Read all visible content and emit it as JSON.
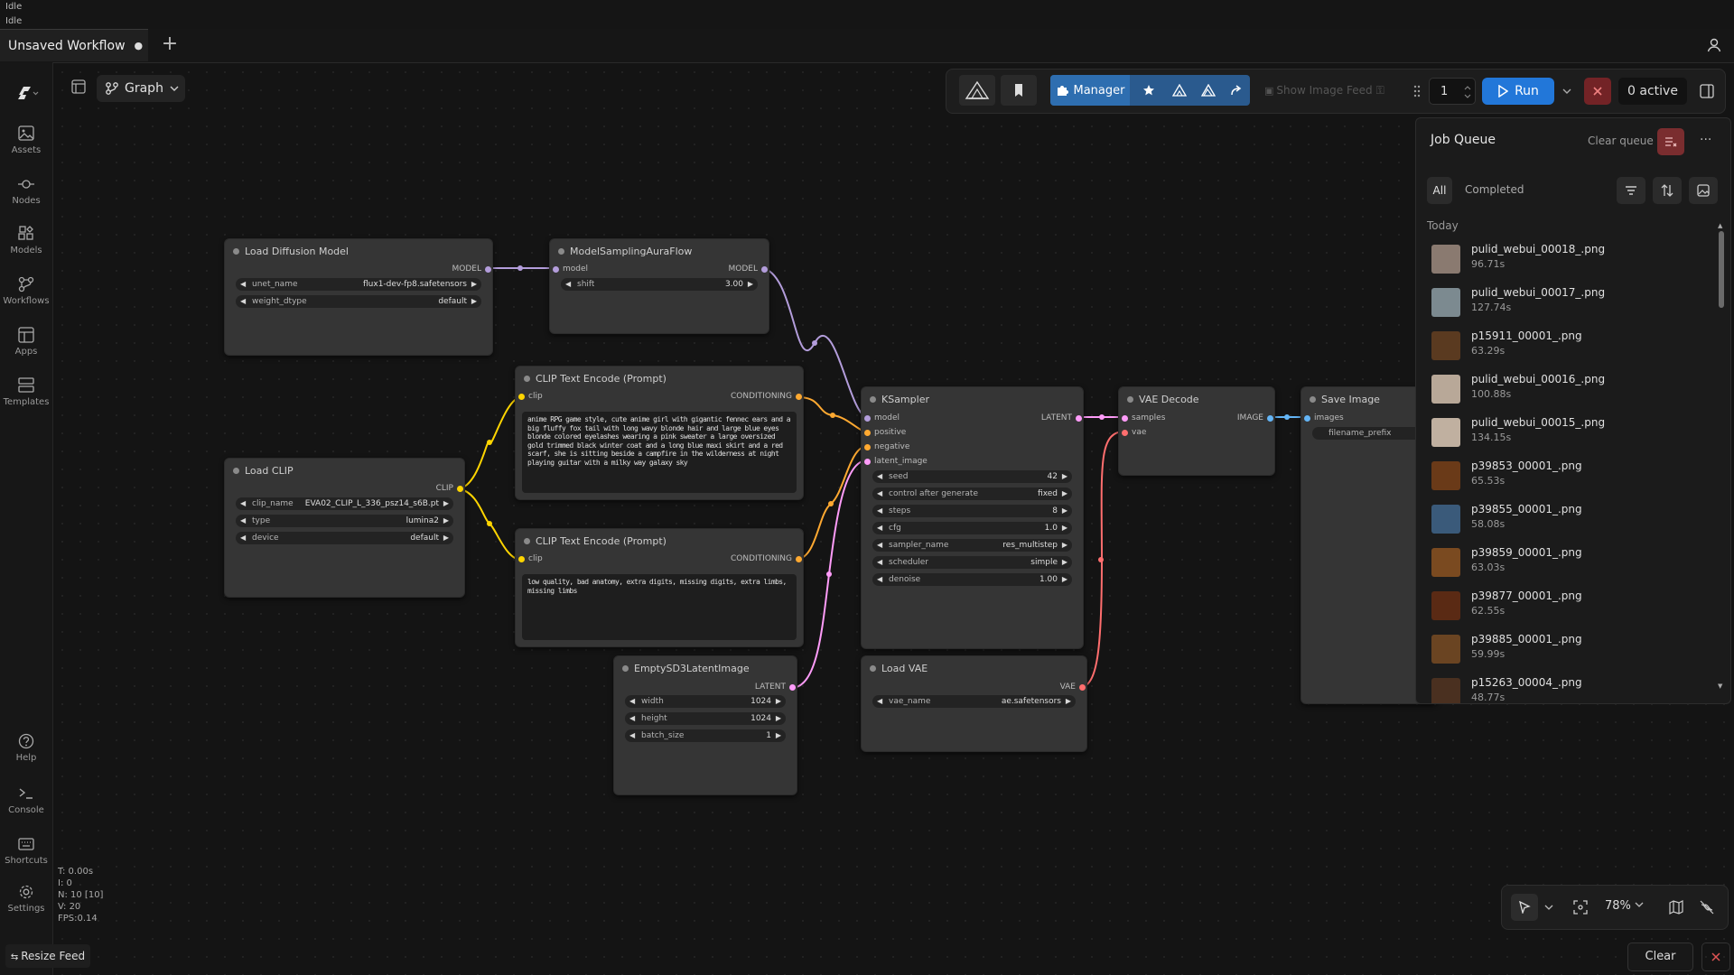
{
  "status": {
    "line1": "Idle",
    "line2": "Idle"
  },
  "tabs": [
    {
      "label": "Unsaved Workflow",
      "modified_marker": "●"
    }
  ],
  "tab_add_label": "+",
  "sidebar": {
    "items": [
      {
        "label": "Assets",
        "icon": "image-icon"
      },
      {
        "label": "Nodes",
        "icon": "nodes-icon"
      },
      {
        "label": "Models",
        "icon": "models-icon"
      },
      {
        "label": "Workflows",
        "icon": "workflow-icon"
      },
      {
        "label": "Apps",
        "icon": "apps-icon"
      },
      {
        "label": "Templates",
        "icon": "templates-icon"
      },
      {
        "label": "Help",
        "icon": "help-icon"
      },
      {
        "label": "Console",
        "icon": "console-icon"
      },
      {
        "label": "Shortcuts",
        "icon": "keyboard-icon"
      },
      {
        "label": "Settings",
        "icon": "gear-icon"
      }
    ]
  },
  "graph_selector": {
    "label": "Graph"
  },
  "toolbar": {
    "manager_label": "Manager",
    "show_image_feed_label": "Show Image Feed",
    "batch_count": "1",
    "run_label": "Run",
    "active_label": "0 active"
  },
  "nodes": {
    "load_diffusion": {
      "title": "Load Diffusion Model",
      "output": "MODEL",
      "widgets": [
        {
          "label": "unet_name",
          "value": "flux1-dev-fp8.safetensors"
        },
        {
          "label": "weight_dtype",
          "value": "default"
        }
      ]
    },
    "model_sampling": {
      "title": "ModelSamplingAuraFlow",
      "input": "model",
      "output": "MODEL",
      "widgets": [
        {
          "label": "shift",
          "value": "3.00"
        }
      ]
    },
    "clip_pos": {
      "title": "CLIP Text Encode (Prompt)",
      "input": "clip",
      "output": "CONDITIONING",
      "text": "anime RPG game style, cute anime girl with gigantic fennec ears and a big fluffy fox tail with long wavy blonde hair and large blue eyes blonde colored eyelashes wearing a pink sweater a large oversized gold trimmed black winter coat and a long blue maxi skirt and a red scarf, she is sitting beside a campfire in the wilderness at night playing guitar with a milky way galaxy sky"
    },
    "clip_neg": {
      "title": "CLIP Text Encode (Prompt)",
      "input": "clip",
      "output": "CONDITIONING",
      "text": "low quality, bad anatomy, extra digits, missing digits, extra limbs, missing limbs"
    },
    "load_clip": {
      "title": "Load CLIP",
      "output": "CLIP",
      "widgets": [
        {
          "label": "clip_name",
          "value": "EVA02_CLIP_L_336_psz14_s6B.pt"
        },
        {
          "label": "type",
          "value": "lumina2"
        },
        {
          "label": "device",
          "value": "default"
        }
      ]
    },
    "empty_latent": {
      "title": "EmptySD3LatentImage",
      "output": "LATENT",
      "widgets": [
        {
          "label": "width",
          "value": "1024"
        },
        {
          "label": "height",
          "value": "1024"
        },
        {
          "label": "batch_size",
          "value": "1"
        }
      ]
    },
    "ksampler": {
      "title": "KSampler",
      "inputs": [
        "model",
        "positive",
        "negative",
        "latent_image"
      ],
      "output": "LATENT",
      "widgets": [
        {
          "label": "seed",
          "value": "42"
        },
        {
          "label": "control after generate",
          "value": "fixed"
        },
        {
          "label": "steps",
          "value": "8"
        },
        {
          "label": "cfg",
          "value": "1.0"
        },
        {
          "label": "sampler_name",
          "value": "res_multistep"
        },
        {
          "label": "scheduler",
          "value": "simple"
        },
        {
          "label": "denoise",
          "value": "1.00"
        }
      ]
    },
    "load_vae": {
      "title": "Load VAE",
      "output": "VAE",
      "widgets": [
        {
          "label": "vae_name",
          "value": "ae.safetensors"
        }
      ]
    },
    "vae_decode": {
      "title": "VAE Decode",
      "inputs": [
        "samples",
        "vae"
      ],
      "output": "IMAGE"
    },
    "save_image": {
      "title": "Save Image",
      "input": "images",
      "widgets": [
        {
          "label": "filename_prefix",
          "value": ""
        }
      ]
    }
  },
  "queue": {
    "title": "Job Queue",
    "clear_label": "Clear queue",
    "more_label": "···",
    "tabs": [
      "All",
      "Completed"
    ],
    "section": "Today",
    "items": [
      {
        "name": "pulid_webui_00018_.png",
        "time": "96.71s",
        "thumb": "#8a7a70"
      },
      {
        "name": "pulid_webui_00017_.png",
        "time": "127.74s",
        "thumb": "#7c8a90"
      },
      {
        "name": "p15911_00001_.png",
        "time": "63.29s",
        "thumb": "#5a3a20"
      },
      {
        "name": "pulid_webui_00016_.png",
        "time": "100.88s",
        "thumb": "#b8a898"
      },
      {
        "name": "pulid_webui_00015_.png",
        "time": "134.15s",
        "thumb": "#c0b0a0"
      },
      {
        "name": "p39853_00001_.png",
        "time": "65.53s",
        "thumb": "#6a3a18"
      },
      {
        "name": "p39855_00001_.png",
        "time": "58.08s",
        "thumb": "#3a5a7a"
      },
      {
        "name": "p39859_00001_.png",
        "time": "63.03s",
        "thumb": "#7a4a20"
      },
      {
        "name": "p39877_00001_.png",
        "time": "62.55s",
        "thumb": "#5a2a14"
      },
      {
        "name": "p39885_00001_.png",
        "time": "59.99s",
        "thumb": "#6a4422"
      },
      {
        "name": "p15263_00004_.png",
        "time": "48.77s",
        "thumb": "#4a3020"
      }
    ]
  },
  "stats": {
    "t": "T: 0.00s",
    "i": "I: 0",
    "n": "N: 10 [10]",
    "v": "V: 20",
    "fps": "FPS:0.14"
  },
  "resize_feed_label": "Resize Feed",
  "zoom_label": "78%",
  "clear_label": "Clear",
  "colors": {
    "model": "#b39ddb",
    "clip": "#ffd500",
    "conditioning": "#ffa931",
    "latent": "#ff9cf9",
    "vae": "#ff6e6e",
    "image": "#64b5f6",
    "run": "#2277d9"
  }
}
